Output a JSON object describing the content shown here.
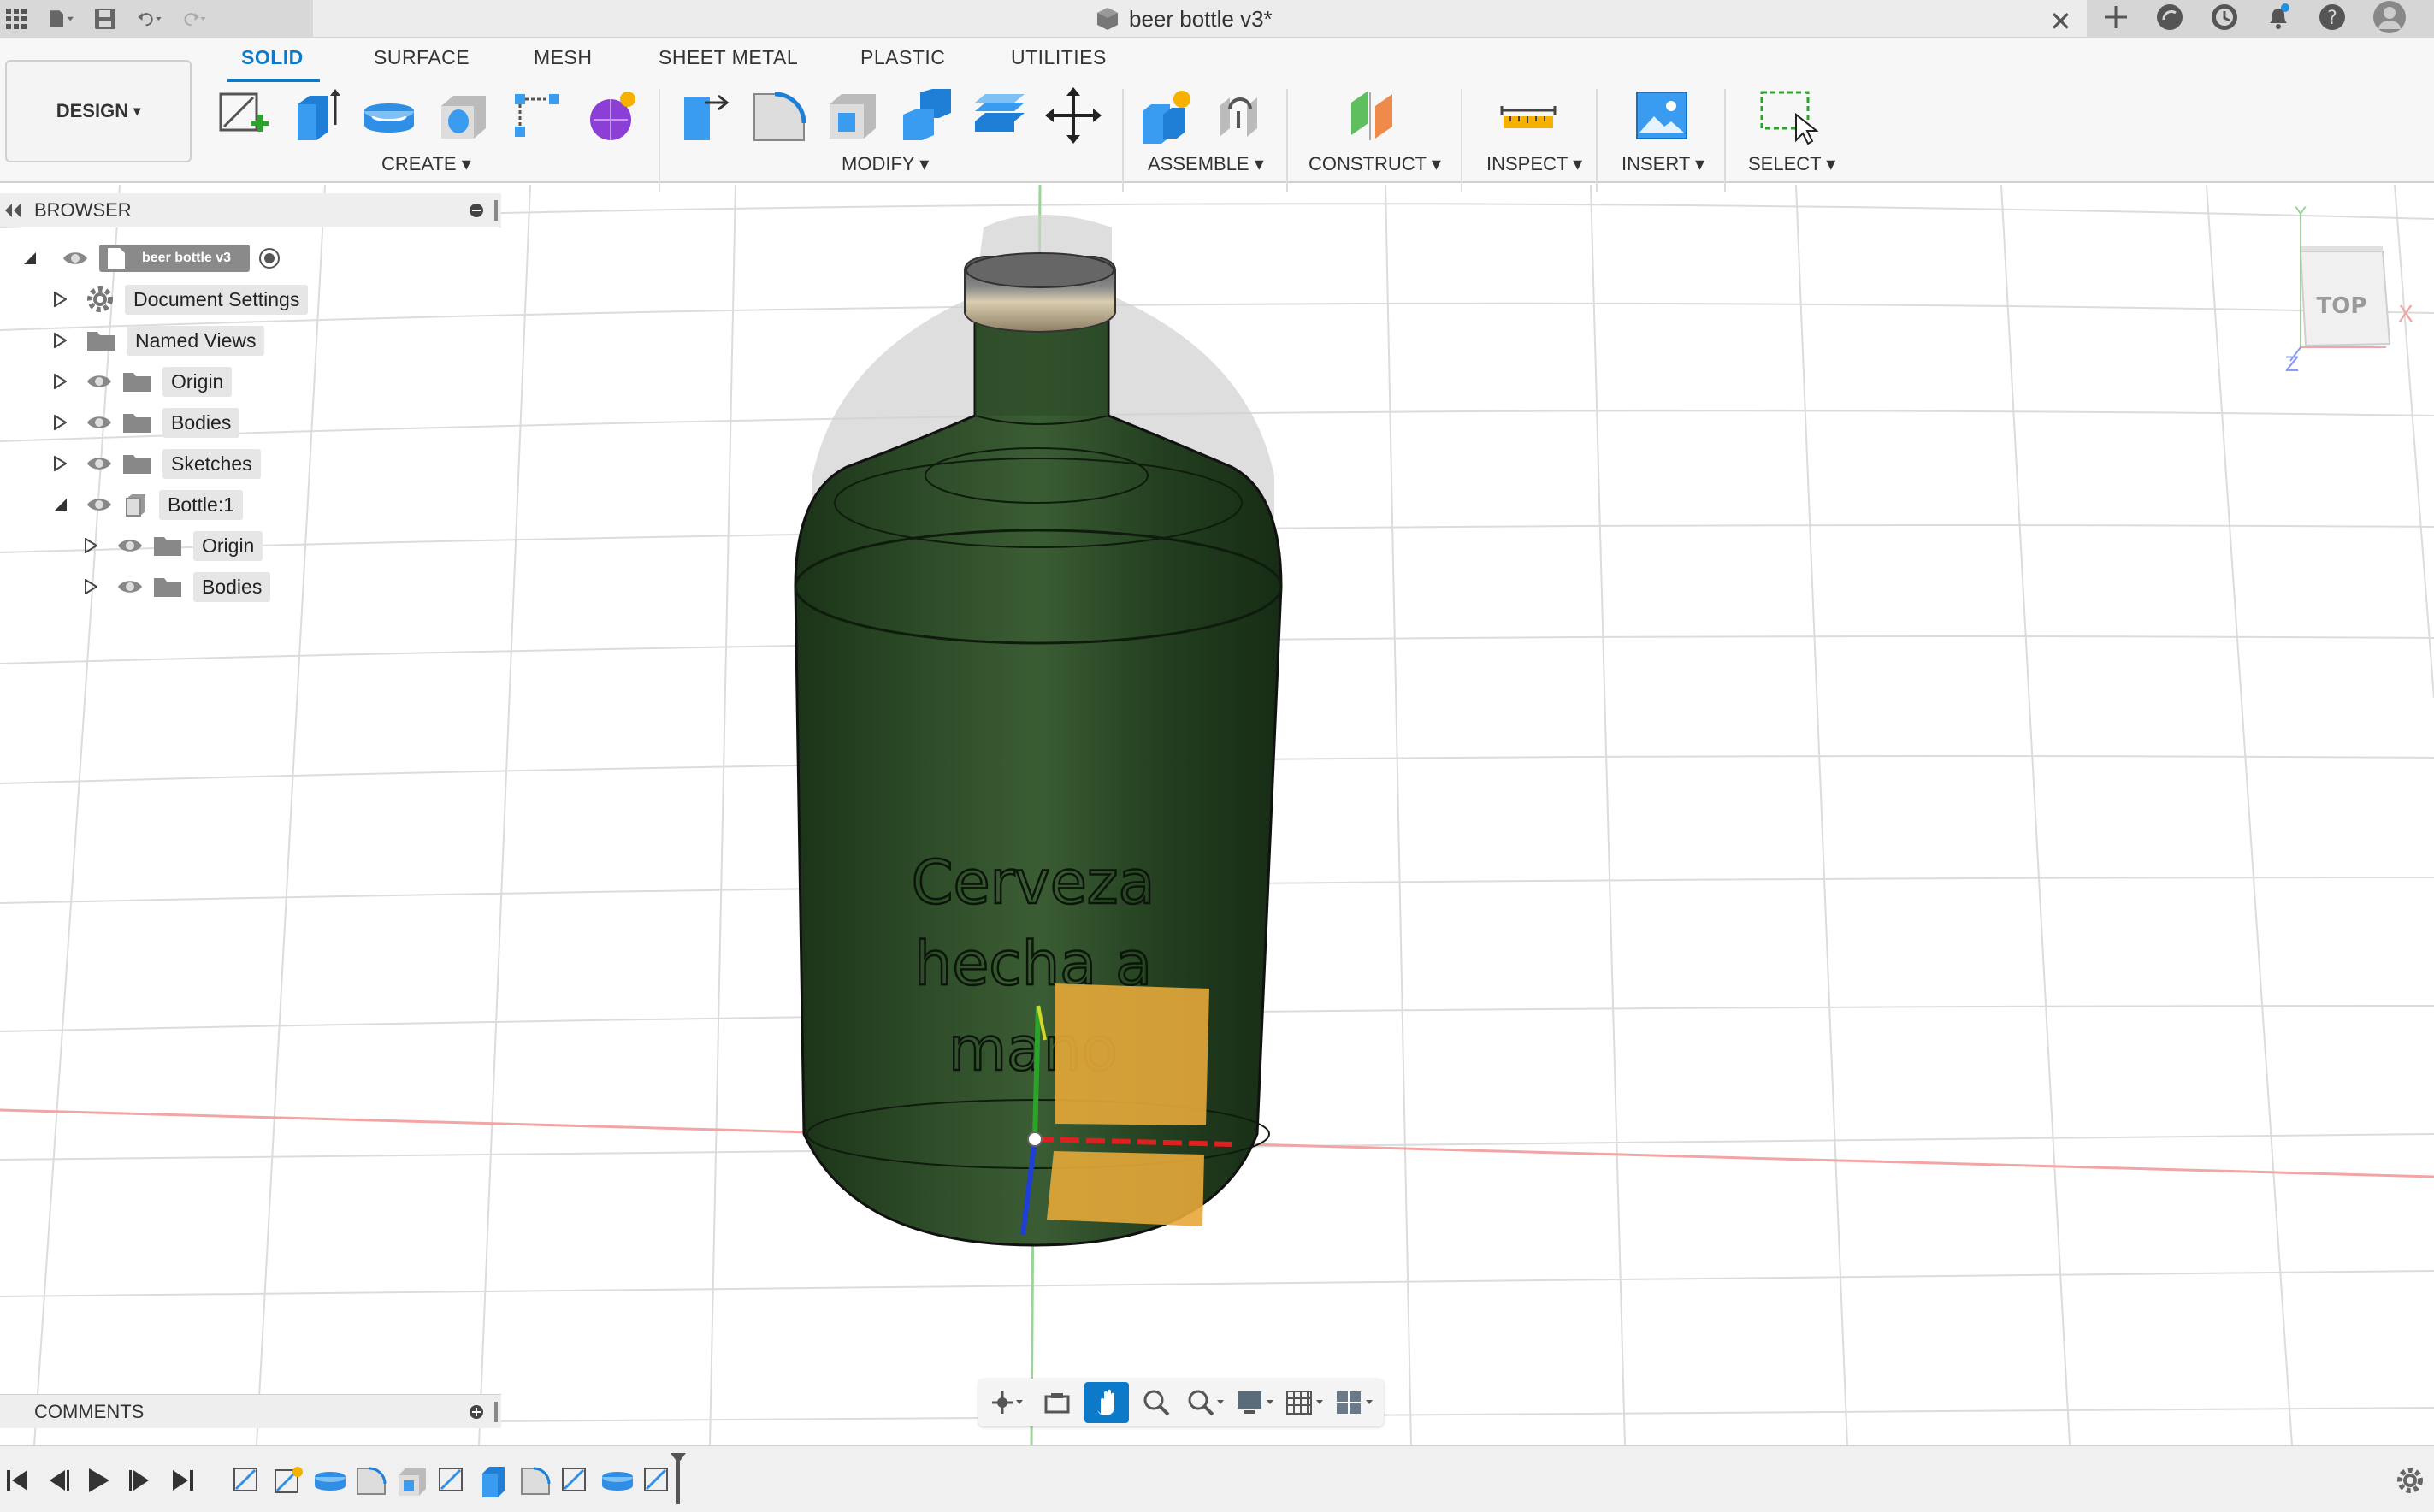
{
  "window": {
    "title": "beer bottle v3*"
  },
  "workspace": {
    "label": "DESIGN",
    "caret": "▾"
  },
  "tabs": [
    "SOLID",
    "SURFACE",
    "MESH",
    "SHEET METAL",
    "PLASTIC",
    "UTILITIES"
  ],
  "active_tab": "SOLID",
  "groups": {
    "create": "CREATE",
    "modify": "MODIFY",
    "assemble": "ASSEMBLE",
    "construct": "CONSTRUCT",
    "inspect": "INSPECT",
    "insert": "INSERT",
    "select": "SELECT"
  },
  "browser": {
    "title": "BROWSER",
    "root": "beer bottle v3",
    "items": [
      {
        "label": "Document Settings",
        "icon": "gear-icon"
      },
      {
        "label": "Named Views",
        "icon": "folder-icon"
      },
      {
        "label": "Origin",
        "icon": "folder-icon"
      },
      {
        "label": "Bodies",
        "icon": "folder-icon"
      },
      {
        "label": "Sketches",
        "icon": "folder-icon"
      },
      {
        "label": "Bottle:1",
        "icon": "component-icon"
      },
      {
        "label": "Origin",
        "icon": "folder-icon"
      },
      {
        "label": "Bodies",
        "icon": "folder-icon"
      }
    ]
  },
  "comments": {
    "title": "COMMENTS"
  },
  "model_text": {
    "line1": "Cerveza",
    "line2": "hecha a",
    "line3": "mano"
  },
  "viewcube": {
    "face": "TOP",
    "axis_x": "X",
    "axis_y": "Y",
    "axis_z": "Z"
  },
  "colors": {
    "accent": "#0d7ac9",
    "bottle": "#1f3b1c",
    "label_box": "#e5a93a"
  }
}
